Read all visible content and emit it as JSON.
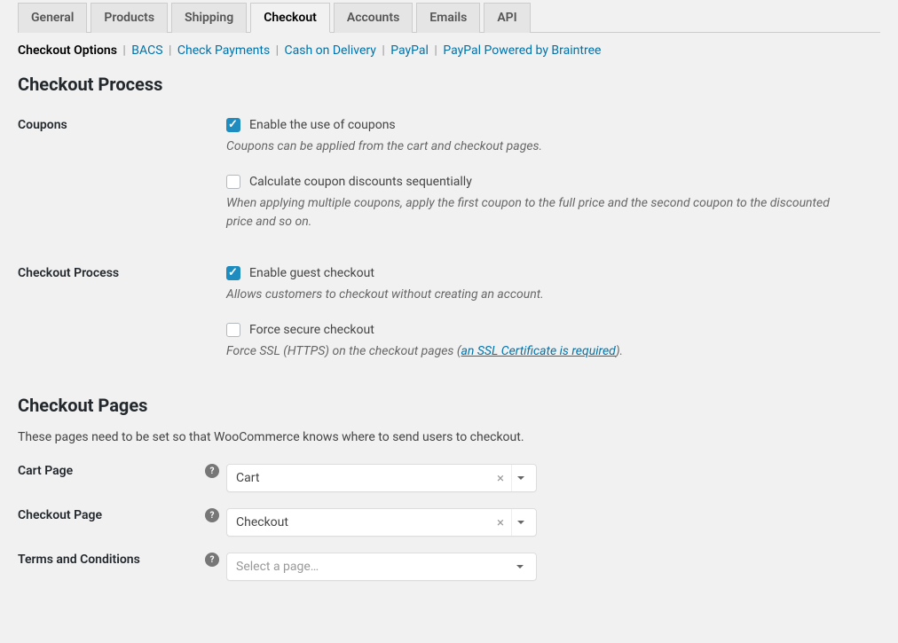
{
  "tabs": [
    "General",
    "Products",
    "Shipping",
    "Checkout",
    "Accounts",
    "Emails",
    "API"
  ],
  "active_tab": "Checkout",
  "subnav": [
    "Checkout Options",
    "BACS",
    "Check Payments",
    "Cash on Delivery",
    "PayPal",
    "PayPal Powered by Braintree"
  ],
  "subnav_active": "Checkout Options",
  "section1": {
    "title": "Checkout Process",
    "coupons": {
      "label": "Coupons",
      "opt1": {
        "label": "Enable the use of coupons",
        "checked": true,
        "hint": "Coupons can be applied from the cart and checkout pages."
      },
      "opt2": {
        "label": "Calculate coupon discounts sequentially",
        "checked": false,
        "hint": "When applying multiple coupons, apply the first coupon to the full price and the second coupon to the discounted price and so on."
      }
    },
    "process": {
      "label": "Checkout Process",
      "opt1": {
        "label": "Enable guest checkout",
        "checked": true,
        "hint": "Allows customers to checkout without creating an account."
      },
      "opt2": {
        "label": "Force secure checkout",
        "checked": false,
        "hint_pre": "Force SSL (HTTPS) on the checkout pages (",
        "hint_link": "an SSL Certificate is required",
        "hint_post": ")."
      }
    }
  },
  "section2": {
    "title": "Checkout Pages",
    "desc": "These pages need to be set so that WooCommerce knows where to send users to checkout.",
    "cart": {
      "label": "Cart Page",
      "value": "Cart",
      "has_value": true
    },
    "checkout": {
      "label": "Checkout Page",
      "value": "Checkout",
      "has_value": true
    },
    "terms": {
      "label": "Terms and Conditions",
      "placeholder": "Select a page…",
      "has_value": false
    }
  }
}
